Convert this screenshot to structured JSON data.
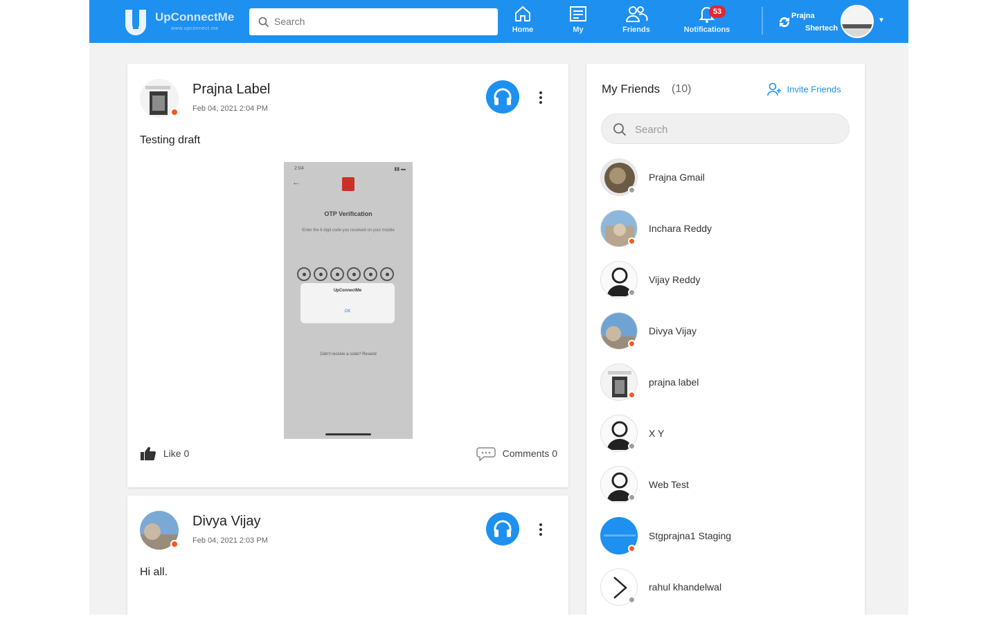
{
  "header": {
    "brand": "UpConnectMe",
    "tagline": "www.upconnect.me",
    "search_placeholder": "Search",
    "nav": {
      "home": "Home",
      "my": "My",
      "friends": "Friends",
      "notifications": "Notifications",
      "notification_count": "53"
    },
    "user_first": "Prajna",
    "user_last": "Shertech"
  },
  "posts": [
    {
      "author": "Prajna Label",
      "date": "Feb 04, 2021 2:04 PM",
      "text": "Testing draft",
      "like_label": "Like",
      "likes": "0",
      "comments_label": "Comments",
      "comments": "0",
      "image": {
        "status_time": "2:04",
        "title": "OTP Verification",
        "subtitle": "Enter the 6 digit code you received on your mobile",
        "dialog_title": "UpConnectMe",
        "dialog_button": "OK",
        "resend": "Didn't receive a code? Resend"
      }
    },
    {
      "author": "Divya Vijay",
      "date": "Feb 04, 2021 2:03 PM",
      "text": "Hi all."
    }
  ],
  "friends_panel": {
    "title": "My Friends",
    "count": "(10)",
    "invite_label": "Invite Friends",
    "search_placeholder": "Search",
    "friends": [
      {
        "name": "Prajna Gmail",
        "status": "offline"
      },
      {
        "name": "Inchara Reddy",
        "status": "online"
      },
      {
        "name": "Vijay Reddy",
        "status": "offline"
      },
      {
        "name": "Divya Vijay",
        "status": "online"
      },
      {
        "name": "prajna label",
        "status": "online"
      },
      {
        "name": "X Y",
        "status": "offline"
      },
      {
        "name": "Web Test",
        "status": "offline"
      },
      {
        "name": "Stgprajna1 Staging",
        "status": "online"
      },
      {
        "name": "rahul khandelwal",
        "status": "offline"
      }
    ]
  },
  "colors": {
    "brand_blue": "#1e90f0",
    "online_dot": "#f25a24",
    "offline_dot": "#9e9e9e",
    "badge_red": "#e8252f"
  }
}
